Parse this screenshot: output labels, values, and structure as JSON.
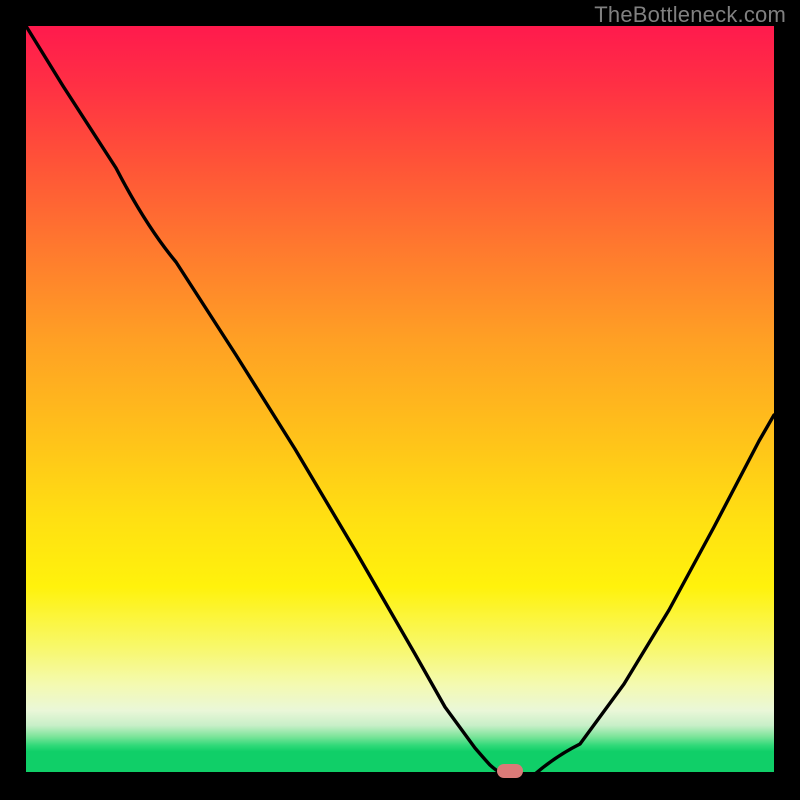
{
  "attribution": "TheBottleneck.com",
  "chart_data": {
    "type": "line",
    "title": "",
    "xlabel": "",
    "ylabel": "",
    "xlim": [
      0,
      100
    ],
    "ylim": [
      0,
      100
    ],
    "x": [
      0,
      5,
      12,
      20,
      28,
      36,
      44,
      52,
      56,
      60,
      62,
      64,
      68,
      74,
      80,
      86,
      92,
      98,
      100
    ],
    "values": [
      100,
      92,
      81,
      68.5,
      56,
      43.5,
      30,
      16,
      9,
      3.5,
      1.2,
      0,
      0,
      4,
      12,
      22,
      33,
      44.5,
      48
    ],
    "marker": {
      "x": 64.5,
      "y": 0,
      "color": "#da7a78"
    },
    "gradient_stops": [
      {
        "pos": 0,
        "color": "#ff1a4d"
      },
      {
        "pos": 0.55,
        "color": "#ffc21a"
      },
      {
        "pos": 0.83,
        "color": "#f8f86a"
      },
      {
        "pos": 0.97,
        "color": "#10cf68"
      }
    ]
  }
}
